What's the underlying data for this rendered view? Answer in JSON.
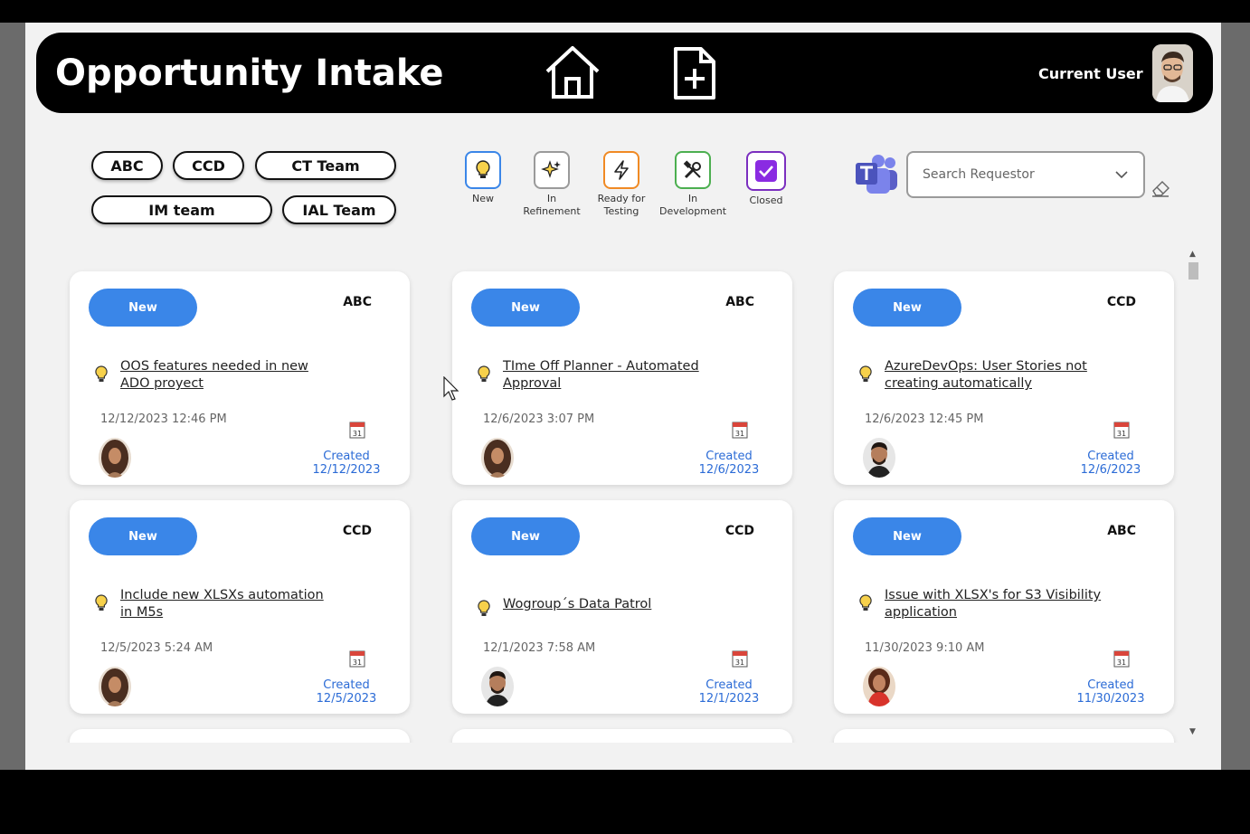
{
  "header": {
    "title": "Opportunity Intake",
    "user_label": "Current User",
    "icons": [
      "home-icon",
      "new-document-icon",
      "avatar"
    ]
  },
  "team_filters": [
    "ABC",
    "CCD",
    "CT Team",
    "IM team",
    "IAL Team"
  ],
  "status_filters": [
    {
      "label": "New",
      "icon": "lightbulb-icon",
      "color": "#3a86e8"
    },
    {
      "label": "In\nRefinement",
      "icon": "sparkles-icon",
      "color": "#9a9a9a"
    },
    {
      "label": "Ready for\nTesting",
      "icon": "lightning-icon",
      "color": "#f08a24"
    },
    {
      "label": "In\nDevelopment",
      "icon": "tools-icon",
      "color": "#4caf50"
    },
    {
      "label": "Closed",
      "icon": "checkbox-icon",
      "color": "#7b2fbf"
    }
  ],
  "search": {
    "placeholder": "Search Requestor"
  },
  "cards": [
    {
      "status": "New",
      "team": "ABC",
      "title": "OOS features needed in new ADO proyect",
      "datetime": "12/12/2023 12:46 PM",
      "created_label": "Created",
      "created_date": "12/12/2023"
    },
    {
      "status": "New",
      "team": "ABC",
      "title": "TIme Off Planner - Automated Approval",
      "datetime": "12/6/2023 3:07 PM",
      "created_label": "Created",
      "created_date": "12/6/2023"
    },
    {
      "status": "New",
      "team": "CCD",
      "title": "AzureDevOps: User Stories not creating automatically",
      "datetime": "12/6/2023 12:45 PM",
      "created_label": "Created",
      "created_date": "12/6/2023"
    },
    {
      "status": "New",
      "team": "CCD",
      "title": "Include new XLSXs automation in M5s",
      "datetime": "12/5/2023 5:24 AM",
      "created_label": "Created",
      "created_date": "12/5/2023"
    },
    {
      "status": "New",
      "team": "CCD",
      "title": "Wogroup´s Data Patrol",
      "datetime": "12/1/2023 7:58 AM",
      "created_label": "Created",
      "created_date": "12/1/2023"
    },
    {
      "status": "New",
      "team": "ABC",
      "title": "Issue with XLSX's for S3 Visibility application",
      "datetime": "11/30/2023 9:10 AM",
      "created_label": "Created",
      "created_date": "11/30/2023"
    }
  ],
  "colors": {
    "accent": "#3a86e8",
    "link": "#2b6bd6",
    "header_bg": "#000000"
  }
}
